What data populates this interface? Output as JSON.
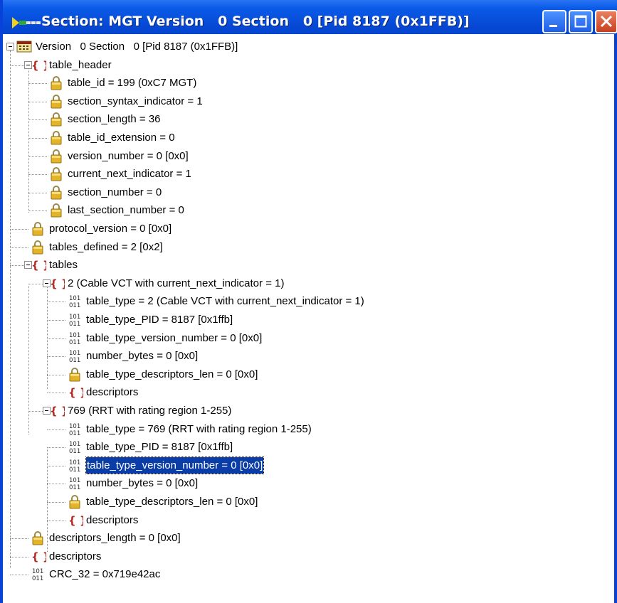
{
  "window": {
    "title": "Section: MGT Version   0 Section   0 [Pid 8187 (0x1FFB)]",
    "buttons": [
      "minimize",
      "maximize",
      "close"
    ],
    "accent": "#0842d9"
  },
  "tree": {
    "root": "Version   0 Section   0 [Pid 8187 (0x1FFB)]",
    "table_header": {
      "label": "table_header",
      "fields": [
        "table_id = 199 (0xC7 MGT)",
        "section_syntax_indicator = 1",
        "section_length = 36",
        "table_id_extension = 0",
        "version_number = 0 [0x0]",
        "current_next_indicator = 1",
        "section_number = 0",
        "last_section_number = 0"
      ]
    },
    "protocol_version": "protocol_version = 0 [0x0]",
    "tables_defined": "tables_defined = 2 [0x2]",
    "tables": {
      "label": "tables",
      "groups": [
        {
          "label": "2 (Cable VCT with current_next_indicator = 1)",
          "table_type": "table_type = 2 (Cable VCT with current_next_indicator = 1)",
          "table_type_PID": "table_type_PID = 8187 [0x1ffb]",
          "table_type_version_number": "table_type_version_number = 0 [0x0]",
          "number_bytes": "number_bytes = 0 [0x0]",
          "table_type_descriptors_len": "table_type_descriptors_len = 0 [0x0]",
          "descriptors": "descriptors"
        },
        {
          "label": "769 (RRT with rating region 1-255)",
          "table_type": "table_type = 769 (RRT with rating region 1-255)",
          "table_type_PID": "table_type_PID = 8187 [0x1ffb]",
          "table_type_version_number": "table_type_version_number = 0 [0x0]",
          "number_bytes": "number_bytes = 0 [0x0]",
          "table_type_descriptors_len": "table_type_descriptors_len = 0 [0x0]",
          "descriptors": "descriptors"
        }
      ]
    },
    "descriptors_length": "descriptors_length = 0 [0x0]",
    "descriptors": "descriptors",
    "crc": "CRC_32 = 0x719e42ac"
  },
  "icons": {
    "bin_top": "101",
    "bin_bottom": "011",
    "braces": "{ }"
  }
}
